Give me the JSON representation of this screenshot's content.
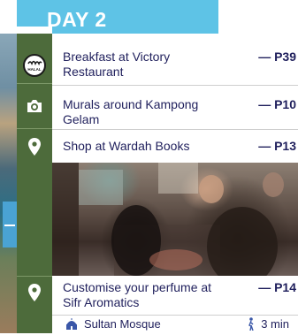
{
  "header": {
    "title": "DAY 2"
  },
  "entries": [
    {
      "icon": "halal-icon",
      "label": "Breakfast at Victory Restaurant",
      "page": "— P39"
    },
    {
      "icon": "camera-icon",
      "label": "Murals around Kampong Gelam",
      "page": "— P10"
    },
    {
      "icon": "location-pin-icon",
      "label": "Shop at Wardah Books",
      "page": "— P13"
    },
    {
      "icon": "location-pin-icon",
      "label": "Customise your perfume at Sifr Aromatics",
      "page": "— P14"
    }
  ],
  "footer": {
    "place_icon": "mosque-icon",
    "place": "Sultan Mosque",
    "walk_icon": "walking-person-icon",
    "walk": "3 min"
  },
  "halal_text": "HALAL",
  "colors": {
    "header": "#5ec3e6",
    "rail": "#4d6b3b",
    "text": "#1f1f5c"
  }
}
